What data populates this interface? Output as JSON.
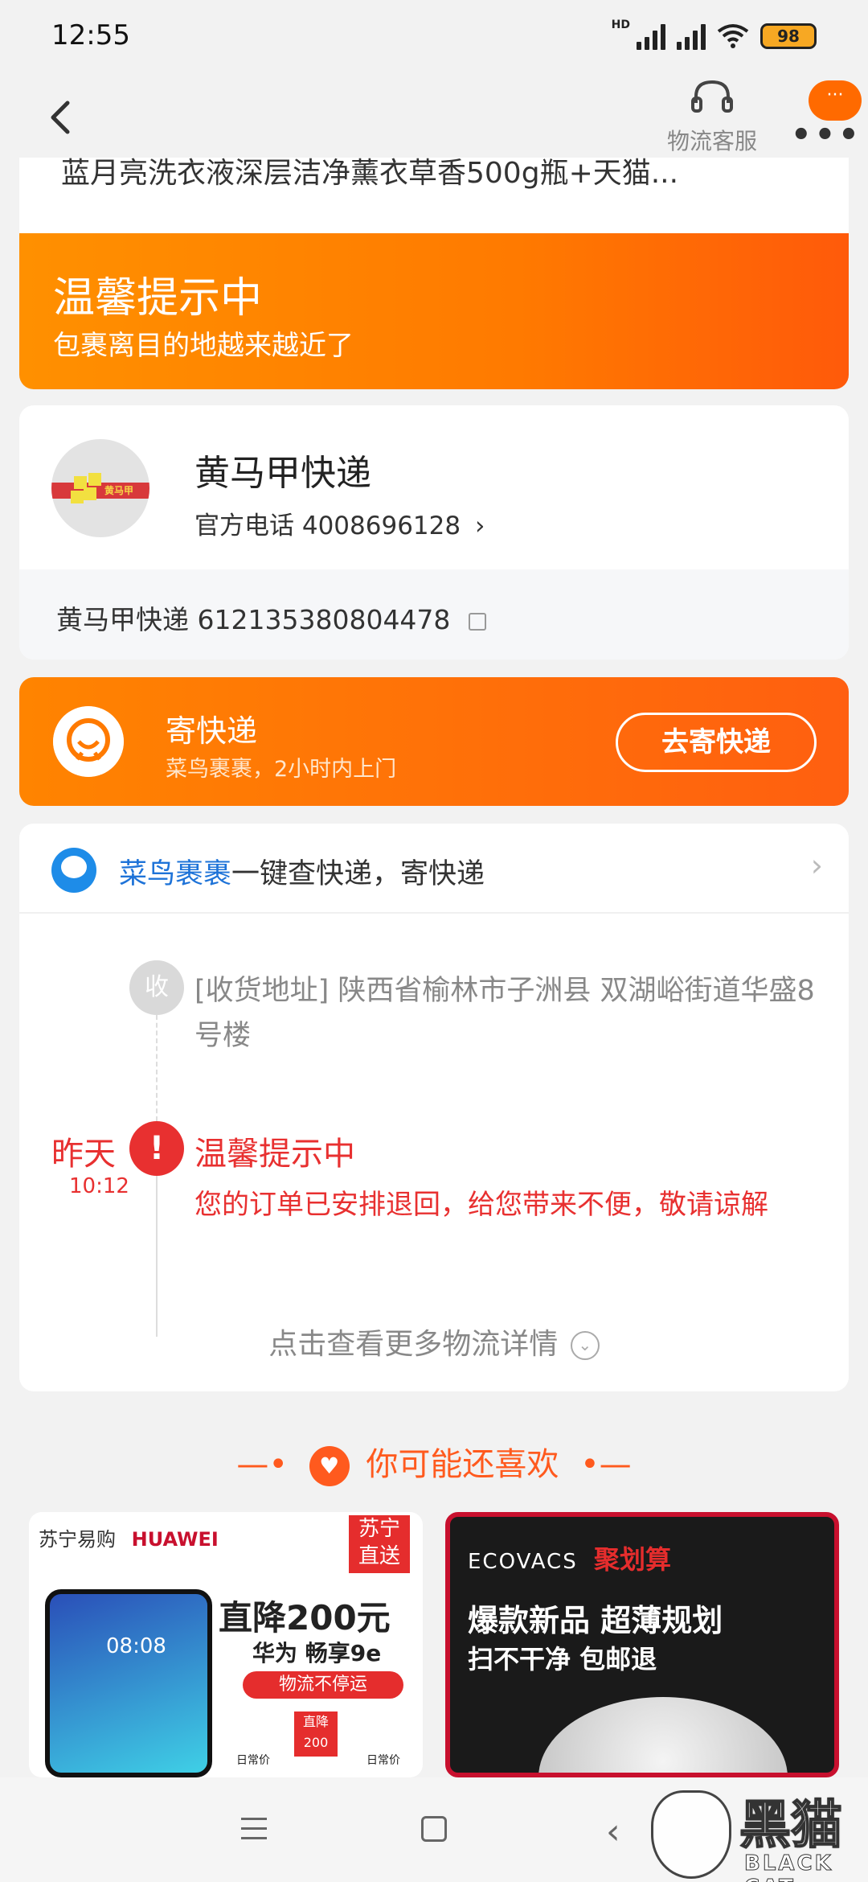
{
  "status_bar": {
    "time": "12:55",
    "hd_label": "HD",
    "battery": "98"
  },
  "header": {
    "customer_service_label": "物流客服",
    "more_bubble": "···",
    "more_dots": "•••"
  },
  "product": {
    "title": "蓝月亮洗衣液深层洁净薰衣草香500g瓶+天猫..."
  },
  "tip_banner": {
    "title": "温馨提示中",
    "subtitle": "包裹离目的地越来越近了"
  },
  "courier": {
    "name": "黄马甲快递",
    "logo_text": "黄马甲",
    "phone_label": "官方电话 4008696128",
    "chevron": "›",
    "tracking": "黄马甲快递 612135380804478"
  },
  "send_express": {
    "title": "寄快递",
    "subtitle": "菜鸟裹裹，2小时内上门",
    "button": "去寄快递"
  },
  "logistics": {
    "cainiao_brand": "菜鸟裹裹",
    "cainiao_text": "一键查快递，寄快递",
    "chevron": "›",
    "recv_badge": "收",
    "address": "[收货地址] 陕西省榆林市子洲县 双湖峪街道华盛8号楼",
    "event_day": "昨天",
    "event_time": "10:12",
    "alert_badge": "!",
    "event_title": "温馨提示中",
    "event_desc": "您的订单已安排退回，给您带来不便，敬请谅解",
    "more_link": "点击查看更多物流详情",
    "more_chev": "⌄"
  },
  "recommend": {
    "title": "你可能还喜欢",
    "left": {
      "brand": "苏宁易购",
      "brand2": "HUAWEI",
      "tag": "苏宁直送",
      "phone_time": "08:08",
      "promo": "直降200元",
      "model": "华为 畅享9e",
      "pill": "物流不停运",
      "price_tag": "直降200",
      "small_left": "日常价",
      "small_right": "日常价"
    },
    "right": {
      "brand": "ECOVACS",
      "brand2": "聚划算",
      "headline": "爆款新品 超薄规划",
      "subline": "扫不干净 包邮退"
    }
  },
  "watermark": {
    "text": "黑猫",
    "sub": "BLACK CAT"
  },
  "nav": {
    "back": "‹"
  }
}
